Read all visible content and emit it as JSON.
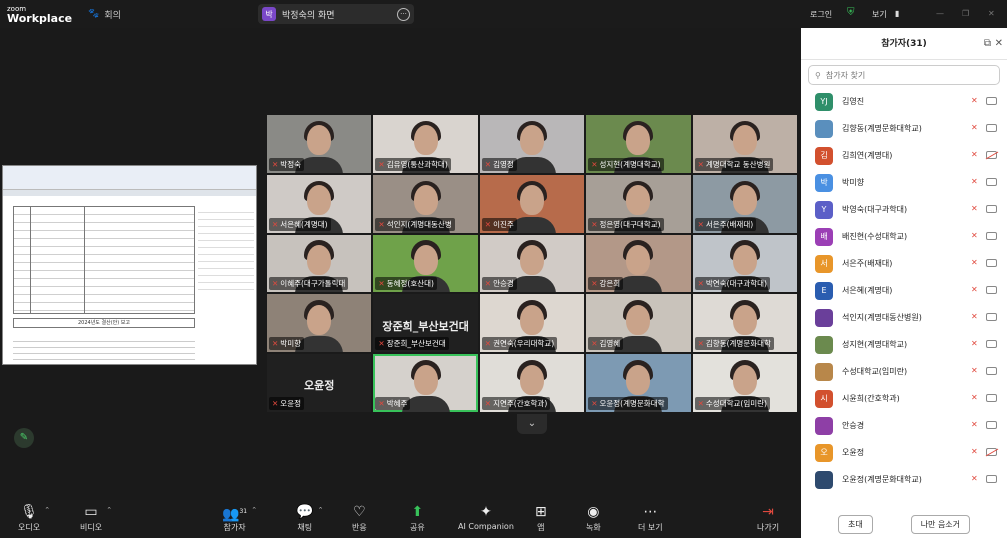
{
  "app": {
    "brand_top": "zoom",
    "brand_bottom": "Workplace",
    "meeting_label": "회의"
  },
  "share": {
    "avatar": "박",
    "label": "박정숙의 화면"
  },
  "topright": {
    "login": "로그인",
    "view": "보기"
  },
  "document": {
    "caption": "2024년도 결산(안) 보고"
  },
  "gallery": {
    "tiles": [
      {
        "name": "박정숙",
        "type": "video",
        "bg": "#8a8a86"
      },
      {
        "name": "김유영(통산과학대)",
        "type": "video",
        "bg": "#d9d4cf"
      },
      {
        "name": "김영정",
        "type": "video",
        "bg": "#b9b7b8"
      },
      {
        "name": "성지현(계명대학교)",
        "type": "video",
        "bg": "#6b8a4e"
      },
      {
        "name": "계명대학교 동산병원",
        "type": "video",
        "bg": "#bdb0a6"
      },
      {
        "name": "서은혜(계명대)",
        "type": "video",
        "bg": "#cfcac6"
      },
      {
        "name": "석인지(계명대동산병",
        "type": "video",
        "bg": "#9a8f86"
      },
      {
        "name": "이진주",
        "type": "video",
        "bg": "#b76b4b"
      },
      {
        "name": "정은영(대구대학교)",
        "type": "video",
        "bg": "#a79f97"
      },
      {
        "name": "서은주(배재대)",
        "type": "video",
        "bg": "#8d9aa3"
      },
      {
        "name": "이혜주(대구가톨릭대",
        "type": "video",
        "bg": "#c7c2bd"
      },
      {
        "name": "동혜정(호산대)",
        "type": "video",
        "bg": "#6fa24a"
      },
      {
        "name": "안승경",
        "type": "video",
        "bg": "#d1cbc6"
      },
      {
        "name": "강은희",
        "type": "video",
        "bg": "#b39888"
      },
      {
        "name": "박연숙(대구과학대)",
        "type": "video",
        "bg": "#bfc4c9"
      },
      {
        "name": "박미향",
        "type": "video",
        "bg": "#8e8277"
      },
      {
        "name": "장준희_부산보건대",
        "type": "text",
        "big": "장준희_부산보건대"
      },
      {
        "name": "권연숙(우리대학교)",
        "type": "video",
        "bg": "#ddd7d0"
      },
      {
        "name": "김영혜",
        "type": "video",
        "bg": "#c9c3bb"
      },
      {
        "name": "김향동(계명문화대학",
        "type": "video",
        "bg": "#dedad5"
      },
      {
        "name": "오윤정",
        "type": "text",
        "big": "오윤정"
      },
      {
        "name": "박혜주",
        "type": "video",
        "bg": "#d5d1cc",
        "highlight": true
      },
      {
        "name": "지연주(간호학과)",
        "type": "video",
        "bg": "#e0ddd8"
      },
      {
        "name": "오윤정(계명문화대학",
        "type": "video",
        "bg": "#7d9ab3"
      },
      {
        "name": "수성대학교(임미란)",
        "type": "video",
        "bg": "#e3e1dc"
      }
    ]
  },
  "toolbar": {
    "audio": "오디오",
    "video": "비디오",
    "participants": "참가자",
    "participants_count": "31",
    "chat": "채팅",
    "react": "반응",
    "share": "공유",
    "ai": "AI Companion",
    "apps": "앱",
    "record": "녹화",
    "more": "더 보기",
    "leave": "나가기"
  },
  "panel": {
    "title": "참가자(31)",
    "search_placeholder": "참가자 찾기",
    "participants": [
      {
        "initial": "YJ",
        "name": "김영진",
        "color": "#2f8f6a",
        "cam_off": false
      },
      {
        "initial": "",
        "name": "김향동(계명문화대학교)",
        "color": "#5a8fbd",
        "cam_off": false
      },
      {
        "initial": "김",
        "name": "김희연(계명대)",
        "color": "#d2502e",
        "cam_off": true
      },
      {
        "initial": "박",
        "name": "박미향",
        "color": "#4a90e2",
        "cam_off": false
      },
      {
        "initial": "Y",
        "name": "박영숙(대구과학대)",
        "color": "#5b5fc7",
        "cam_off": false
      },
      {
        "initial": "배",
        "name": "배진현(수성대학교)",
        "color": "#9b3fb5",
        "cam_off": false
      },
      {
        "initial": "서",
        "name": "서은주(배재대)",
        "color": "#e8962a",
        "cam_off": false
      },
      {
        "initial": "E",
        "name": "서은혜(계명대)",
        "color": "#2a5db0",
        "cam_off": false
      },
      {
        "initial": "",
        "name": "석인지(계명대동산병원)",
        "color": "#6a3f9a",
        "cam_off": false
      },
      {
        "initial": "",
        "name": "성지현(계명대학교)",
        "color": "#6b8a4e",
        "cam_off": false
      },
      {
        "initial": "",
        "name": "수성대학교(임미란)",
        "color": "#b8874a",
        "cam_off": false
      },
      {
        "initial": "시",
        "name": "시윤희(간호학과)",
        "color": "#d2502e",
        "cam_off": false
      },
      {
        "initial": "",
        "name": "안승경",
        "color": "#8e3fa6",
        "cam_off": false
      },
      {
        "initial": "오",
        "name": "오윤정",
        "color": "#e8962a",
        "cam_off": true
      },
      {
        "initial": "",
        "name": "오윤정(계명문화대학교)",
        "color": "#2e4a6e",
        "cam_off": false
      }
    ],
    "invite_label": "초대",
    "mute_me_label": "나만 음소거"
  }
}
